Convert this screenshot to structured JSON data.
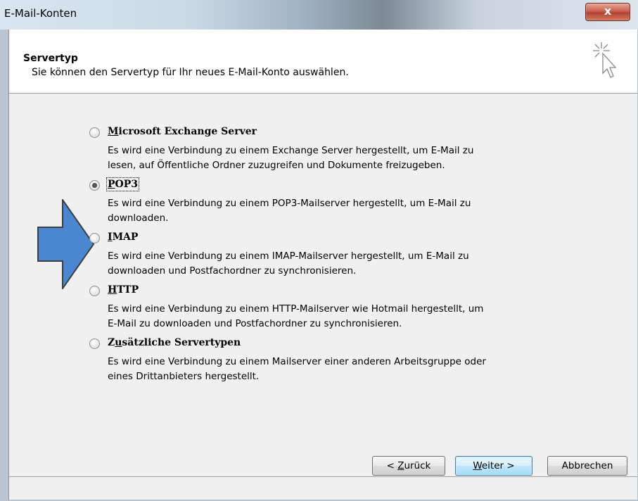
{
  "window": {
    "title": "E-Mail-Konten",
    "close_label": "x"
  },
  "header": {
    "title": "Servertyp",
    "subtitle": "Sie können den Servertyp für Ihr neues E-Mail-Konto auswählen."
  },
  "options": [
    {
      "label_prefix": "",
      "label_accel": "M",
      "label_rest": "icrosoft Exchange Server",
      "selected": false,
      "desc_line1": "Es wird eine Verbindung zu einem Exchange Server hergestellt, um E-Mail zu",
      "desc_line2": "lesen, auf Öffentliche Ordner zuzugreifen und Dokumente freizugeben."
    },
    {
      "label_prefix": "",
      "label_accel": "P",
      "label_rest": "OP3",
      "selected": true,
      "desc_line1": "Es wird eine Verbindung zu einem POP3-Mailserver hergestellt, um E-Mail zu",
      "desc_line2": "downloaden."
    },
    {
      "label_prefix": "",
      "label_accel": "I",
      "label_rest": "MAP",
      "selected": false,
      "desc_line1": "Es wird eine Verbindung zu einem IMAP-Mailserver hergestellt, um E-Mail zu",
      "desc_line2": "downloaden und Postfachordner zu synchronisieren."
    },
    {
      "label_prefix": "",
      "label_accel": "H",
      "label_rest": "TTP",
      "selected": false,
      "desc_line1": "Es wird eine Verbindung zu einem HTTP-Mailserver wie Hotmail hergestellt, um",
      "desc_line2": "E-Mail zu downloaden und Postfachordner zu synchronisieren."
    },
    {
      "label_prefix": "Z",
      "label_accel": "u",
      "label_rest": "sätzliche Servertypen",
      "selected": false,
      "desc_line1": "Es wird eine Verbindung zu einem Mailserver einer anderen Arbeitsgruppe oder",
      "desc_line2": "eines Drittanbieters hergestellt."
    }
  ],
  "buttons": {
    "back_prefix": "< ",
    "back_accel": "Z",
    "back_rest": "urück",
    "next_prefix": "",
    "next_accel": "W",
    "next_rest": "eiter >",
    "cancel": "Abbrechen"
  },
  "colors": {
    "arrow_fill": "#4a87d0",
    "arrow_stroke": "#3a3f47"
  },
  "icons": {
    "wizard": "wizard-cursor-icon",
    "annotation": "right-arrow-annotation"
  }
}
